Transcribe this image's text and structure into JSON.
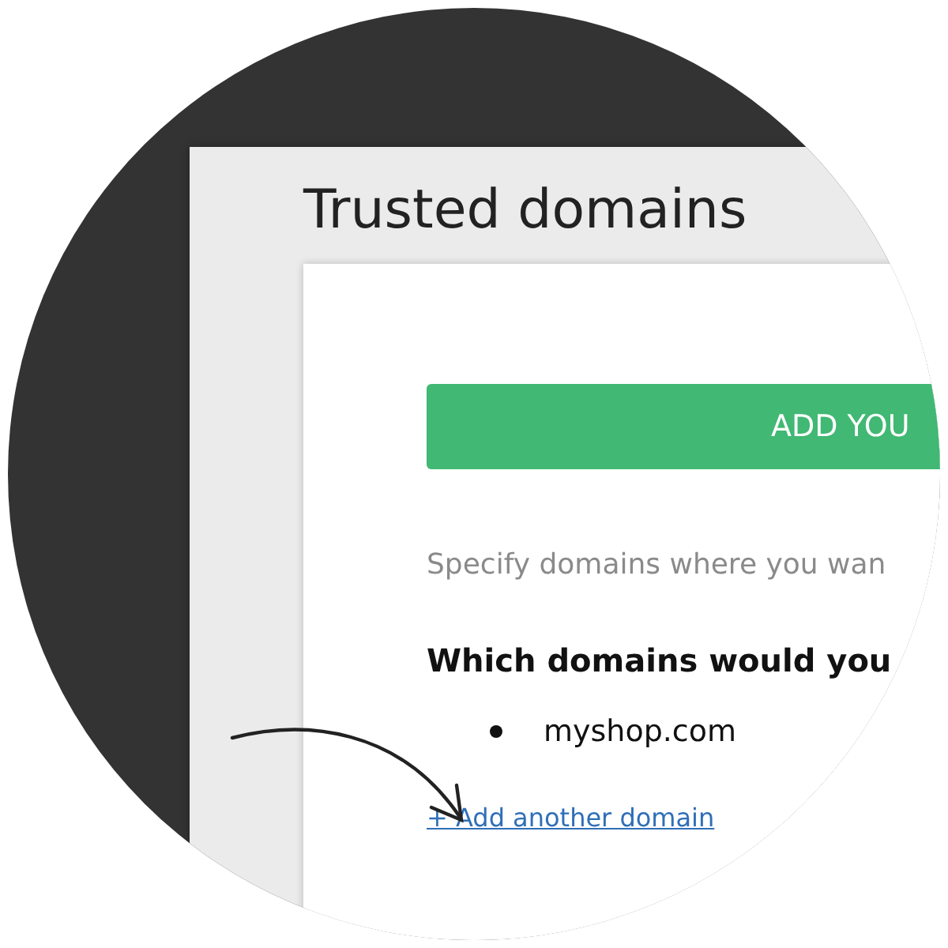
{
  "page_title": "Trusted domains",
  "add_button": {
    "label": "ADD YOU"
  },
  "description": "Specify domains where you wan",
  "question": "Which domains would you",
  "domains": [
    "myshop.com"
  ],
  "add_link": "+ Add another domain"
}
